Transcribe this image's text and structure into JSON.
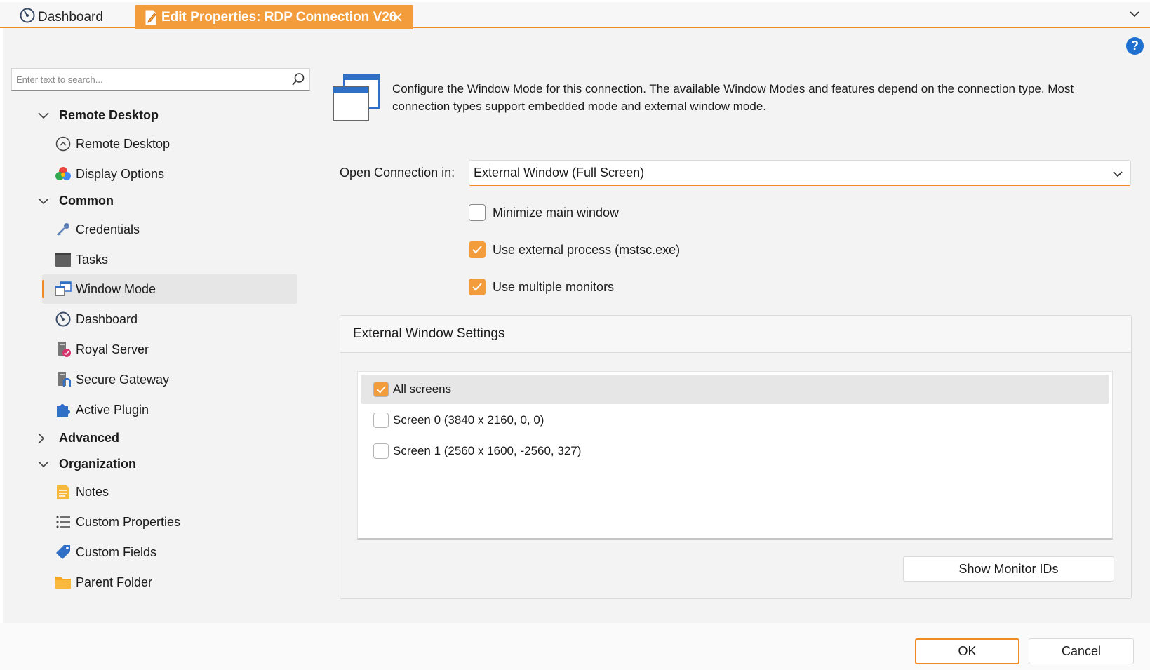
{
  "tabs": {
    "dashboard": "Dashboard",
    "active": "Edit Properties: RDP Connection V26",
    "close_glyph": "✕"
  },
  "help_glyph": "?",
  "search": {
    "placeholder": "Enter text to search..."
  },
  "nav": {
    "groups": {
      "remote_desktop": "Remote Desktop",
      "common": "Common",
      "advanced": "Advanced",
      "organization": "Organization"
    },
    "items": {
      "remote_desktop": "Remote Desktop",
      "display_options": "Display Options",
      "credentials": "Credentials",
      "tasks": "Tasks",
      "window_mode": "Window Mode",
      "dashboard": "Dashboard",
      "royal_server": "Royal Server",
      "secure_gateway": "Secure Gateway",
      "active_plugin": "Active Plugin",
      "notes": "Notes",
      "custom_properties": "Custom Properties",
      "custom_fields": "Custom Fields",
      "parent_folder": "Parent Folder"
    },
    "selected": "window_mode"
  },
  "main": {
    "description": "Configure the Window Mode for this connection. The available Window Modes and features depend on the connection type. Most connection types support embedded mode and external window mode.",
    "open_label": "Open Connection in:",
    "open_value": "External Window (Full Screen)",
    "options": {
      "minimize": {
        "label": "Minimize main window",
        "checked": false
      },
      "external_process": {
        "label": "Use external process (mstsc.exe)",
        "checked": true
      },
      "multiple_monitors": {
        "label": "Use multiple monitors",
        "checked": true
      }
    },
    "external_settings": {
      "title": "External Window Settings",
      "screens": [
        {
          "label": "All screens",
          "checked": true
        },
        {
          "label": "Screen 0 (3840 x 2160, 0, 0)",
          "checked": false
        },
        {
          "label": "Screen 1 (2560 x 1600, -2560, 327)",
          "checked": false
        }
      ],
      "show_monitor_ids": "Show Monitor IDs"
    }
  },
  "footer": {
    "ok": "OK",
    "cancel": "Cancel"
  },
  "colors": {
    "accent": "#f08a24",
    "accent_fill": "#f39c3c",
    "help": "#1f6fd1"
  }
}
